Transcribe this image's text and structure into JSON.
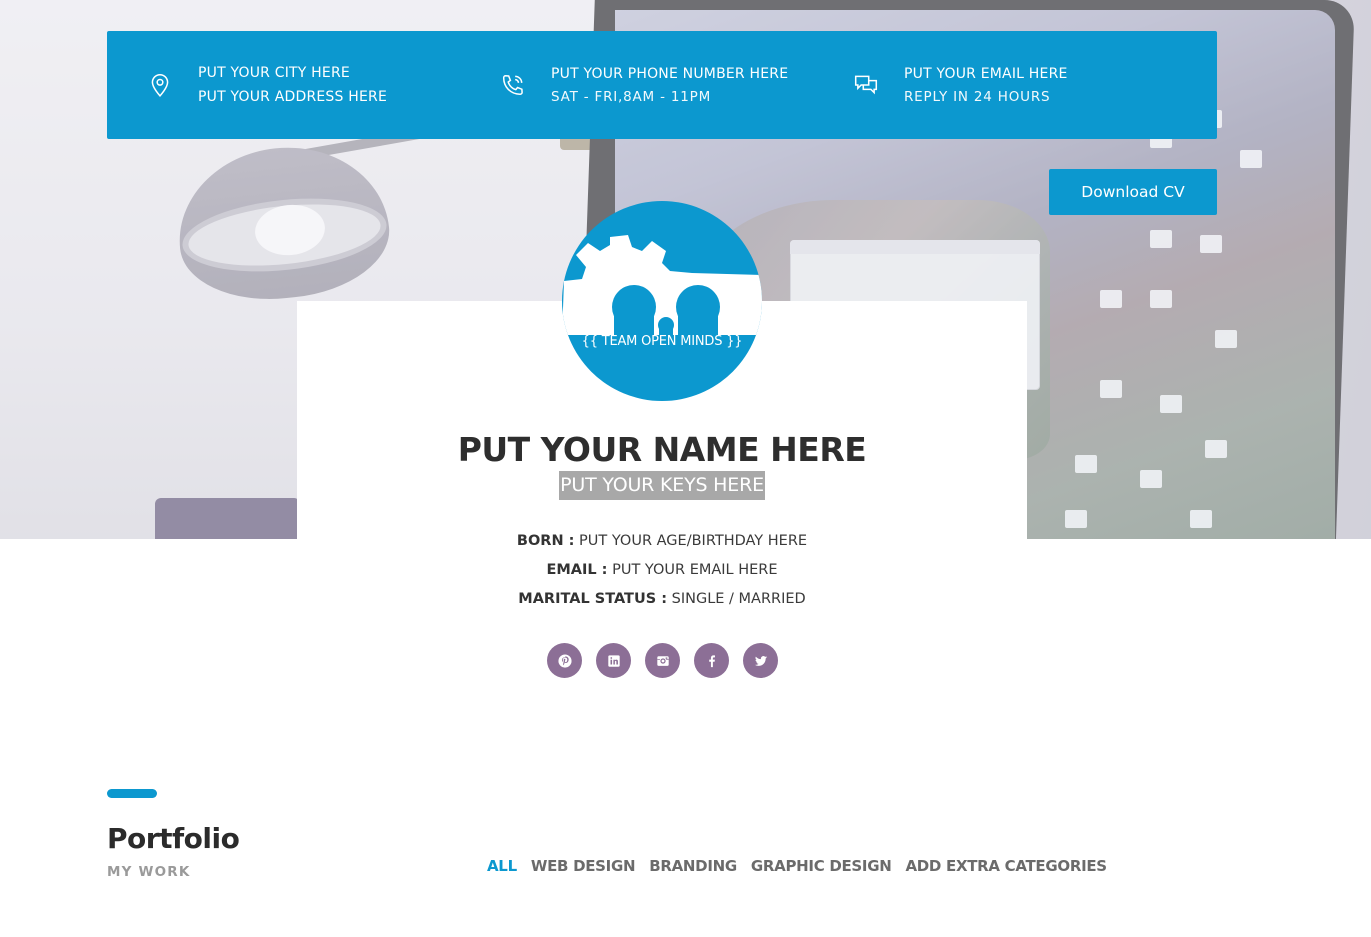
{
  "contact": {
    "location": {
      "icon": "map-pin-icon",
      "line1": "PUT YOUR CITY HERE",
      "line2": "PUT YOUR ADDRESS HERE"
    },
    "phone": {
      "icon": "phone-icon",
      "line1": "PUT YOUR PHONE NUMBER HERE",
      "line2": "SAT - FRI,8AM - 11PM"
    },
    "email": {
      "icon": "chat-bubbles-icon",
      "line1": "PUT YOUR EMAIL HERE",
      "line2": "REPLY IN 24 HOURS"
    }
  },
  "download_button": {
    "label": "Download CV"
  },
  "profile": {
    "avatar_text": "{{ TEAM OPEN MINDS }}",
    "name": "PUT YOUR NAME HERE",
    "keys": "PUT YOUR KEYS HERE",
    "born_label": "BORN :",
    "born_value": "PUT YOUR AGE/BIRTHDAY HERE",
    "email_label": "EMAIL :",
    "email_value": "PUT YOUR EMAIL HERE",
    "marital_label": "MARITAL STATUS :",
    "marital_value": "SINGLE / MARRIED"
  },
  "socials": [
    {
      "name": "pinterest",
      "icon": "pinterest-icon"
    },
    {
      "name": "linkedin",
      "icon": "linkedin-icon"
    },
    {
      "name": "instagram",
      "icon": "instagram-icon"
    },
    {
      "name": "facebook",
      "icon": "facebook-icon"
    },
    {
      "name": "twitter",
      "icon": "twitter-icon"
    }
  ],
  "portfolio": {
    "title": "Portfolio",
    "subtitle": "MY WORK",
    "filters": [
      "ALL",
      "WEB DESIGN",
      "BRANDING",
      "GRAPHIC DESIGN",
      "ADD EXTRA CATEGORIES"
    ],
    "active_filter": "ALL"
  },
  "colors": {
    "accent": "#0c98cf",
    "social_bg": "#8c6f96",
    "keys_bg": "#a8a8a8",
    "text_dark": "#2e2e2e",
    "text_muted": "#9a9a9a"
  }
}
